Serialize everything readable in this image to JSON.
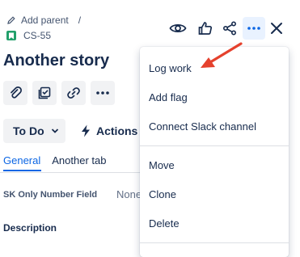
{
  "breadcrumb": {
    "parent_label": "Add parent",
    "separator": "/",
    "issue_key": "CS-55",
    "story_icon": "story-icon"
  },
  "issue": {
    "title": "Another story"
  },
  "toolbar_icons": [
    "paperclip-icon",
    "checklist-icon",
    "link-icon",
    "more-icon"
  ],
  "header_actions": [
    "eye-icon",
    "thumbs-up-icon",
    "share-icon",
    "more-icon",
    "close-icon"
  ],
  "status": {
    "label": "To Do",
    "actions_label": "Actions"
  },
  "tabs": [
    {
      "label": "General",
      "active": true
    },
    {
      "label": "Another tab",
      "active": false
    }
  ],
  "fields": [
    {
      "label": "SK Only Number Field",
      "value": "None"
    }
  ],
  "description": {
    "label": "Description"
  },
  "menu": {
    "groups": [
      [
        "Log work",
        "Add flag",
        "Connect Slack channel"
      ],
      [
        "Move",
        "Clone",
        "Delete"
      ]
    ]
  },
  "colors": {
    "accent": "#0c66e4",
    "story_green": "#22a06b",
    "annotation_arrow": "#e5412d"
  }
}
